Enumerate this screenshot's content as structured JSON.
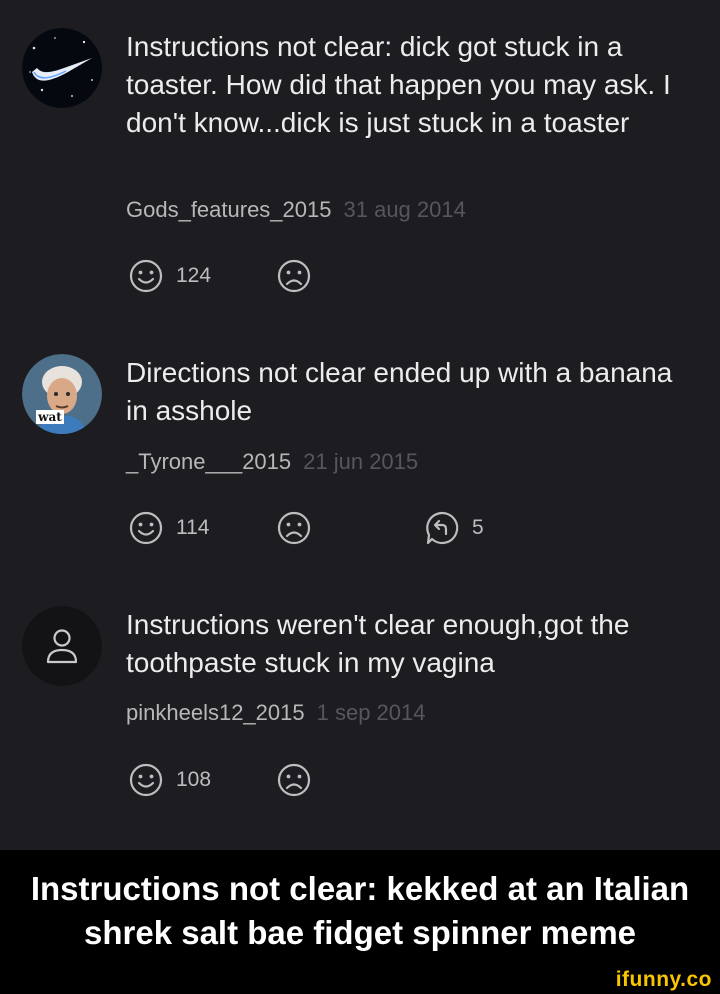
{
  "comments": [
    {
      "avatar_icon": "starry-swoosh-avatar",
      "text": "Instructions not clear: dick got stuck in a toaster. How did that happen you may ask. I don't know...dick is just stuck in a toaster",
      "username": "Gods_features_2015",
      "date": "31 aug 2014",
      "smile_count": "124"
    },
    {
      "avatar_icon": "wat-photo-avatar",
      "avatar_text": "wat",
      "text": "Directions not clear ended up with a banana in asshole",
      "username": "_Tyrone___2015",
      "date": "21 jun 2015",
      "smile_count": "114",
      "reply_count": "5"
    },
    {
      "avatar_icon": "default-user-avatar",
      "text": "Instructions weren't clear enough,got the toothpaste stuck in my vagina",
      "username": "pinkheels12_2015",
      "date": "1 sep 2014",
      "smile_count": "108"
    }
  ],
  "banner": {
    "line1": "Instructions not clear: kekked at an Italian",
    "line2": "shrek salt bae fidget spinner meme"
  },
  "watermark": "ifunny.co",
  "colors": {
    "background": "#1d1d21",
    "text": "#ececec",
    "username": "#b7b7b9",
    "date": "#56565b",
    "watermark": "#f7c600"
  }
}
